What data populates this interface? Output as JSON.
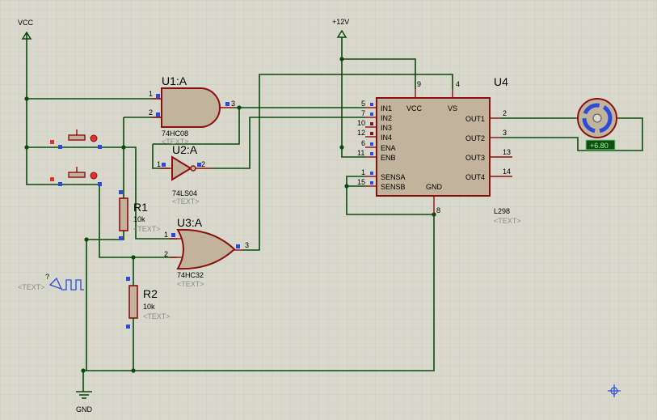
{
  "colors": {
    "background": "#d8d8cc",
    "grid": "#c3c3b5",
    "wire": "#0c4a0c",
    "component_body": "#c2b49c",
    "component_outline": "#8a0f0f",
    "pin_marker_blue": "#2b4bd8",
    "pin_marker_red": "#e03030",
    "placeholder_text": "#8c8c8c",
    "probe_bg": "#0f4f12",
    "probe_text": "#9cff9c"
  },
  "power": {
    "vcc": "VCC",
    "v12": "+12V",
    "gnd": "GND"
  },
  "u1": {
    "ref": "U1:A",
    "part": "74HC08",
    "placeholder": "<TEXT>",
    "pins": [
      "1",
      "2",
      "3"
    ]
  },
  "u2": {
    "ref": "U2:A",
    "part": "74LS04",
    "placeholder": "<TEXT>",
    "pins": [
      "1",
      "2"
    ]
  },
  "u3": {
    "ref": "U3:A",
    "part": "74HC32",
    "placeholder": "<TEXT>",
    "pins": [
      "1",
      "2",
      "3"
    ]
  },
  "r1": {
    "ref": "R1",
    "value": "10k",
    "placeholder": "<TEXT>"
  },
  "r2": {
    "ref": "R2",
    "value": "10k",
    "placeholder": "<TEXT>"
  },
  "u4": {
    "ref": "U4",
    "part": "L298",
    "placeholder": "<TEXT>",
    "inner": {
      "vcc": "VCC",
      "vs": "VS",
      "gnd": "GND",
      "in1": "IN1",
      "in2": "IN2",
      "in3": "IN3",
      "in4": "IN4",
      "ena": "ENA",
      "enb": "ENB",
      "sensa": "SENSA",
      "sensb": "SENSB",
      "out1": "OUT1",
      "out2": "OUT2",
      "out3": "OUT3",
      "out4": "OUT4"
    },
    "pin_numbers": {
      "in1": "5",
      "in2": "7",
      "in3": "10",
      "in4": "12",
      "ena": "6",
      "enb": "11",
      "sensa": "1",
      "sensb": "15",
      "vcc": "9",
      "vs": "4",
      "gnd": "8",
      "out1": "2",
      "out2": "3",
      "out3": "13",
      "out4": "14"
    }
  },
  "motor": {
    "probe_value": "+6.80"
  },
  "signal_source": {
    "placeholder": "<TEXT>",
    "question": "?"
  }
}
